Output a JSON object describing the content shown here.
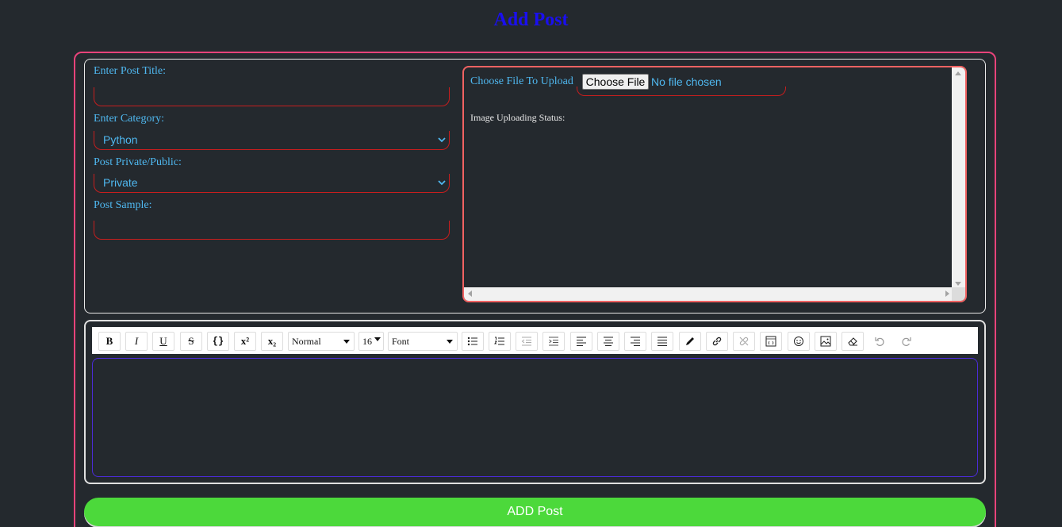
{
  "page": {
    "title": "Add Post"
  },
  "form": {
    "title_label": "Enter Post Title:",
    "title_value": "",
    "category_label": "Enter Category:",
    "category_value": "Python",
    "visibility_label": "Post Private/Public:",
    "visibility_value": "Private",
    "sample_label": "Post Sample:",
    "sample_value": ""
  },
  "upload": {
    "label": "Choose File To Upload",
    "button_label": "Choose File",
    "file_status": "No file chosen",
    "status_label": "Image Uploading Status:"
  },
  "editor": {
    "format_select": "Normal",
    "size_select": "16",
    "font_select": "Font",
    "content": "",
    "buttons": [
      {
        "name": "bold",
        "glyph": "B"
      },
      {
        "name": "italic",
        "glyph": "I"
      },
      {
        "name": "underline",
        "glyph": "U"
      },
      {
        "name": "strikethrough",
        "glyph": "S"
      },
      {
        "name": "code",
        "glyph": "{}"
      },
      {
        "name": "superscript",
        "glyph": "x²"
      },
      {
        "name": "subscript",
        "glyph": "x₂"
      }
    ]
  },
  "actions": {
    "submit_label": "ADD Post"
  },
  "colors": {
    "background": "#24292e",
    "title": "#1a0ff0",
    "label": "#4fb8f0",
    "accent_frame": "#e8437a",
    "submit": "#4cd93b"
  }
}
